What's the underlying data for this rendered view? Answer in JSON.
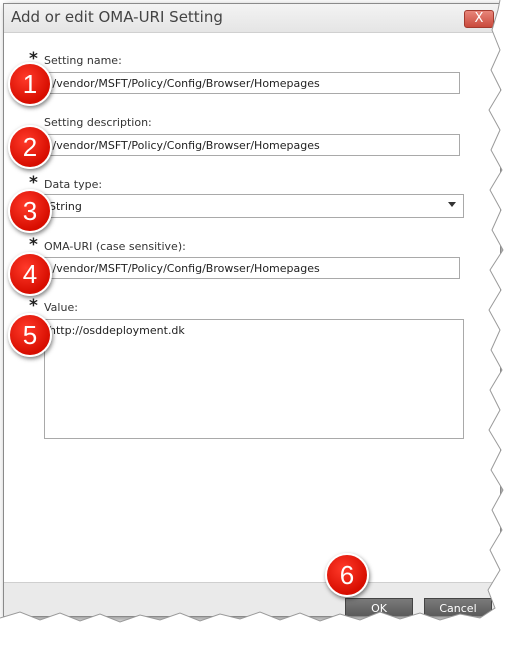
{
  "dialog": {
    "title": "Add or edit OMA-URI Setting",
    "close_label": "X"
  },
  "required_marker": "*",
  "fields": {
    "setting_name": {
      "label": "Setting name:",
      "value": "./vendor/MSFT/Policy/Config/Browser/Homepages"
    },
    "setting_description": {
      "label": "Setting description:",
      "value": "./vendor/MSFT/Policy/Config/Browser/Homepages"
    },
    "data_type": {
      "label": "Data type:",
      "value": "String"
    },
    "oma_uri": {
      "label": "OMA-URI (case sensitive):",
      "value": "./vendor/MSFT/Policy/Config/Browser/Homepages"
    },
    "value": {
      "label": "Value:",
      "value": "http://osddeployment.dk"
    }
  },
  "badges": [
    "1",
    "2",
    "3",
    "4",
    "5",
    "6"
  ],
  "footer": {
    "ok_label": "OK",
    "cancel_label": "Cancel"
  },
  "colors": {
    "badge": "#e01b0e",
    "button": "#666666"
  }
}
